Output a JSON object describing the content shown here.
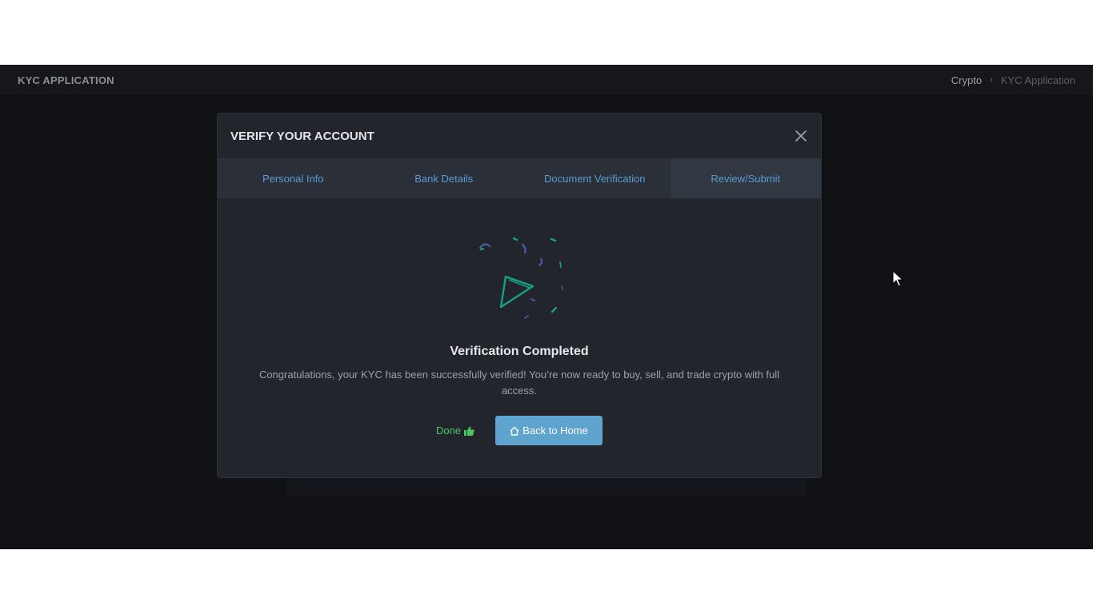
{
  "topbar": {
    "title": "KYC APPLICATION",
    "breadcrumb": {
      "link": "Crypto",
      "separator": "›",
      "current": "KYC Application"
    }
  },
  "modal": {
    "title": "VERIFY YOUR ACCOUNT",
    "close_icon": "close-icon",
    "tabs": [
      {
        "label": "Personal Info"
      },
      {
        "label": "Bank Details"
      },
      {
        "label": "Document Verification"
      },
      {
        "label": "Review/Submit",
        "active": true
      }
    ],
    "illustration_icon": "confetti-icon",
    "status_title": "Verification Completed",
    "status_message": "Congratulations, your KYC has been successfully verified! You’re now ready to buy, sell, and trade crypto with full access.",
    "done_label": "Done",
    "done_icon": "thumbs-up-icon",
    "home_label": "Back to Home",
    "home_icon": "home-icon"
  },
  "colors": {
    "accent": "#5fa3cf",
    "success": "#4cc763",
    "tab_text": "#5a9bd1",
    "confetti_green": "#16a085",
    "confetti_blue": "#4a5cab"
  }
}
